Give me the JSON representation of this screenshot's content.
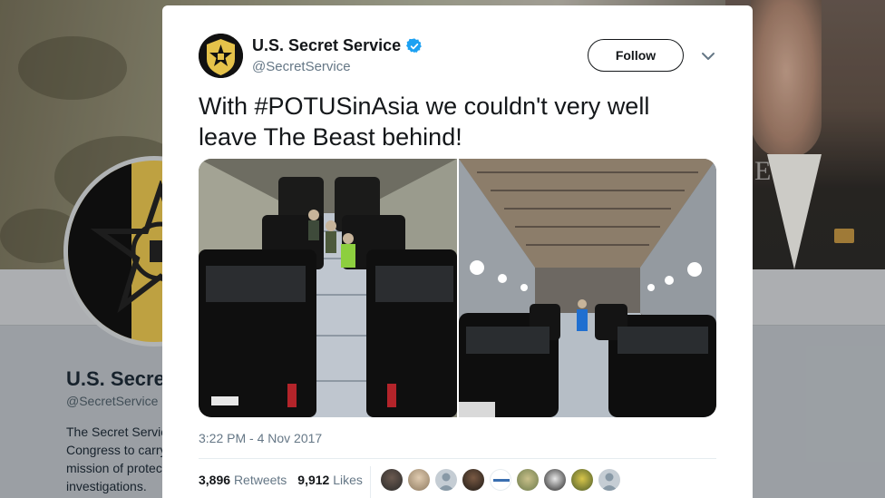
{
  "background_profile": {
    "name": "U.S. Secret",
    "handle": "@SecretService",
    "bio_lines": [
      "The Secret Servic",
      "Congress to carry",
      "mission of protec",
      "investigations."
    ]
  },
  "tweet": {
    "author_name": "U.S. Secret Service",
    "author_handle": "@SecretService",
    "verified": true,
    "follow_label": "Follow",
    "text": "With #POTUSinAsia we couldn't very well leave The Beast behind!",
    "timestamp": "3:22 PM - 4 Nov 2017",
    "retweets_count": "3,896",
    "retweets_label": "Retweets",
    "likes_count": "9,912",
    "likes_label": "Likes"
  },
  "media": [
    {
      "name": "photo-cargo-hold-vehicles-left"
    },
    {
      "name": "photo-cargo-hold-vehicles-right"
    }
  ],
  "likers": [
    "liker-1",
    "liker-2",
    "liker-3",
    "liker-4",
    "liker-5",
    "liker-6",
    "liker-7",
    "liker-8",
    "liker-9"
  ],
  "colors": {
    "verified_blue": "#1da1f2",
    "text_primary": "#14171a",
    "text_secondary": "#657786",
    "logo_gold": "#e5c24a"
  }
}
